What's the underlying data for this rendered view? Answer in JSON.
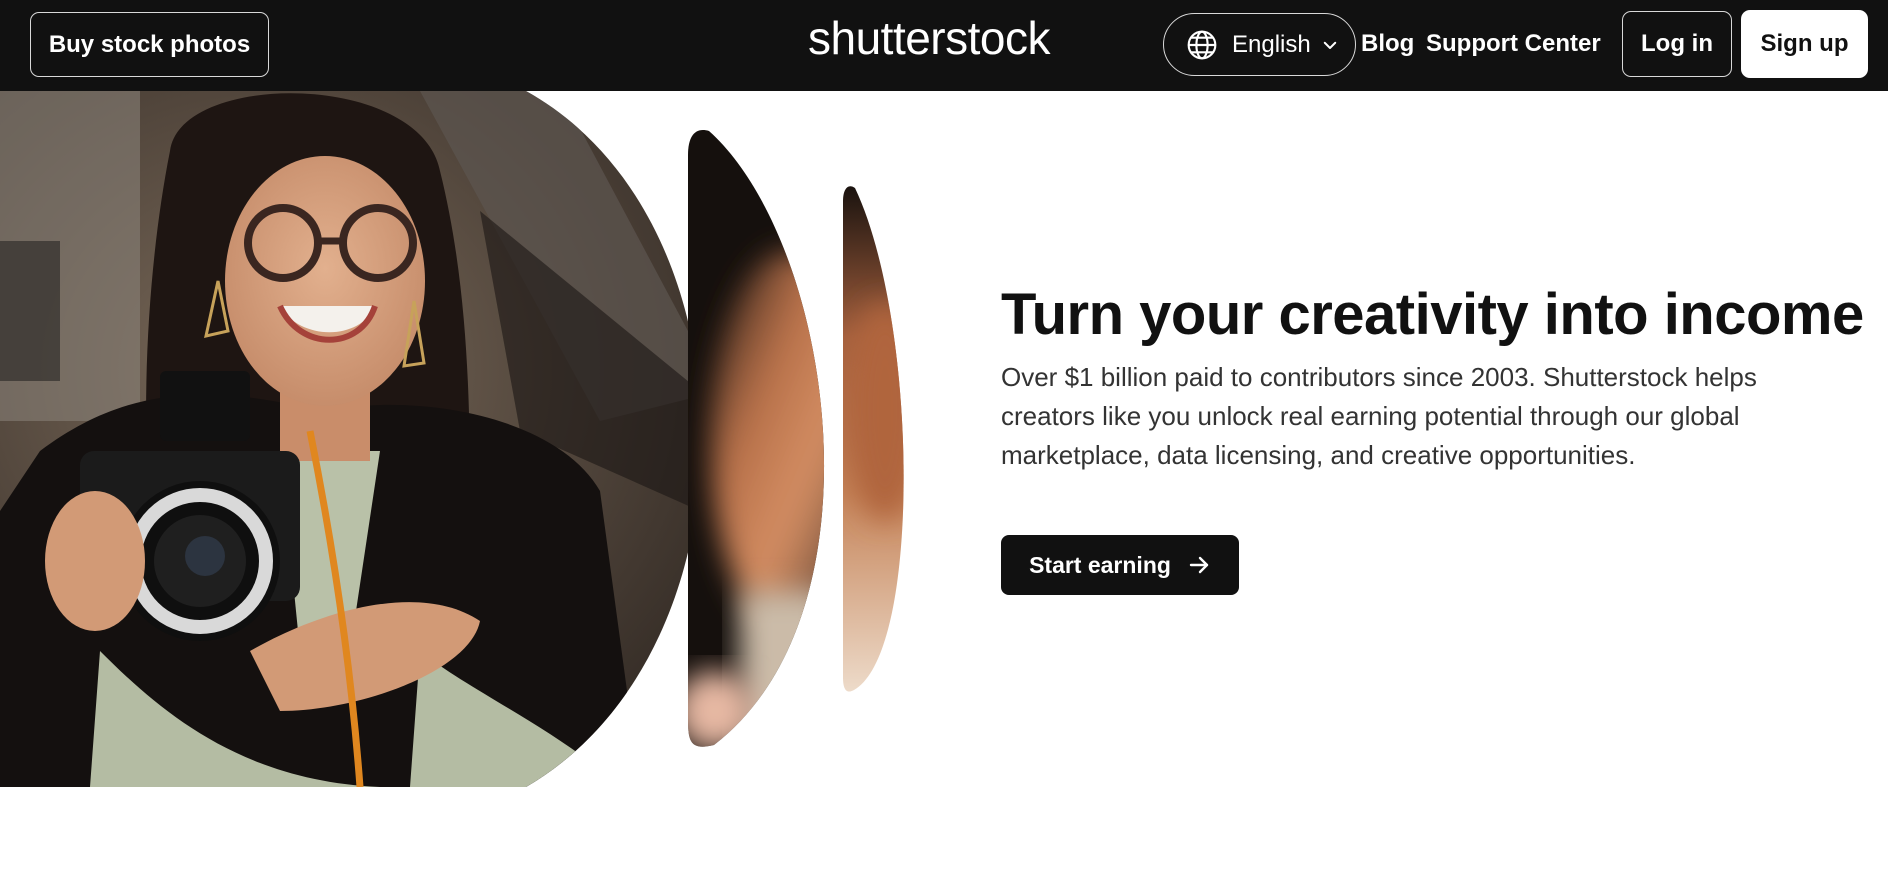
{
  "header": {
    "buy_label": "Buy stock photos",
    "logo_text": "shutterstock",
    "language": "English",
    "nav": {
      "blog": "Blog",
      "support": "Support Center"
    },
    "login_label": "Log in",
    "signup_label": "Sign up"
  },
  "hero": {
    "headline": "Turn your creativity into income",
    "subcopy": "Over $1 billion paid to contributors since 2003. Shutterstock helps creators like you unlock real earning potential through our global marketplace, data licensing, and creative opportunities.",
    "cta_label": "Start earning"
  },
  "icons": {
    "language": "globe-icon",
    "language_toggle": "chevron-down-icon",
    "cta": "arrow-right-icon"
  },
  "colors": {
    "header_bg": "#111111",
    "cta_bg": "#111111",
    "page_bg": "#ffffff"
  }
}
